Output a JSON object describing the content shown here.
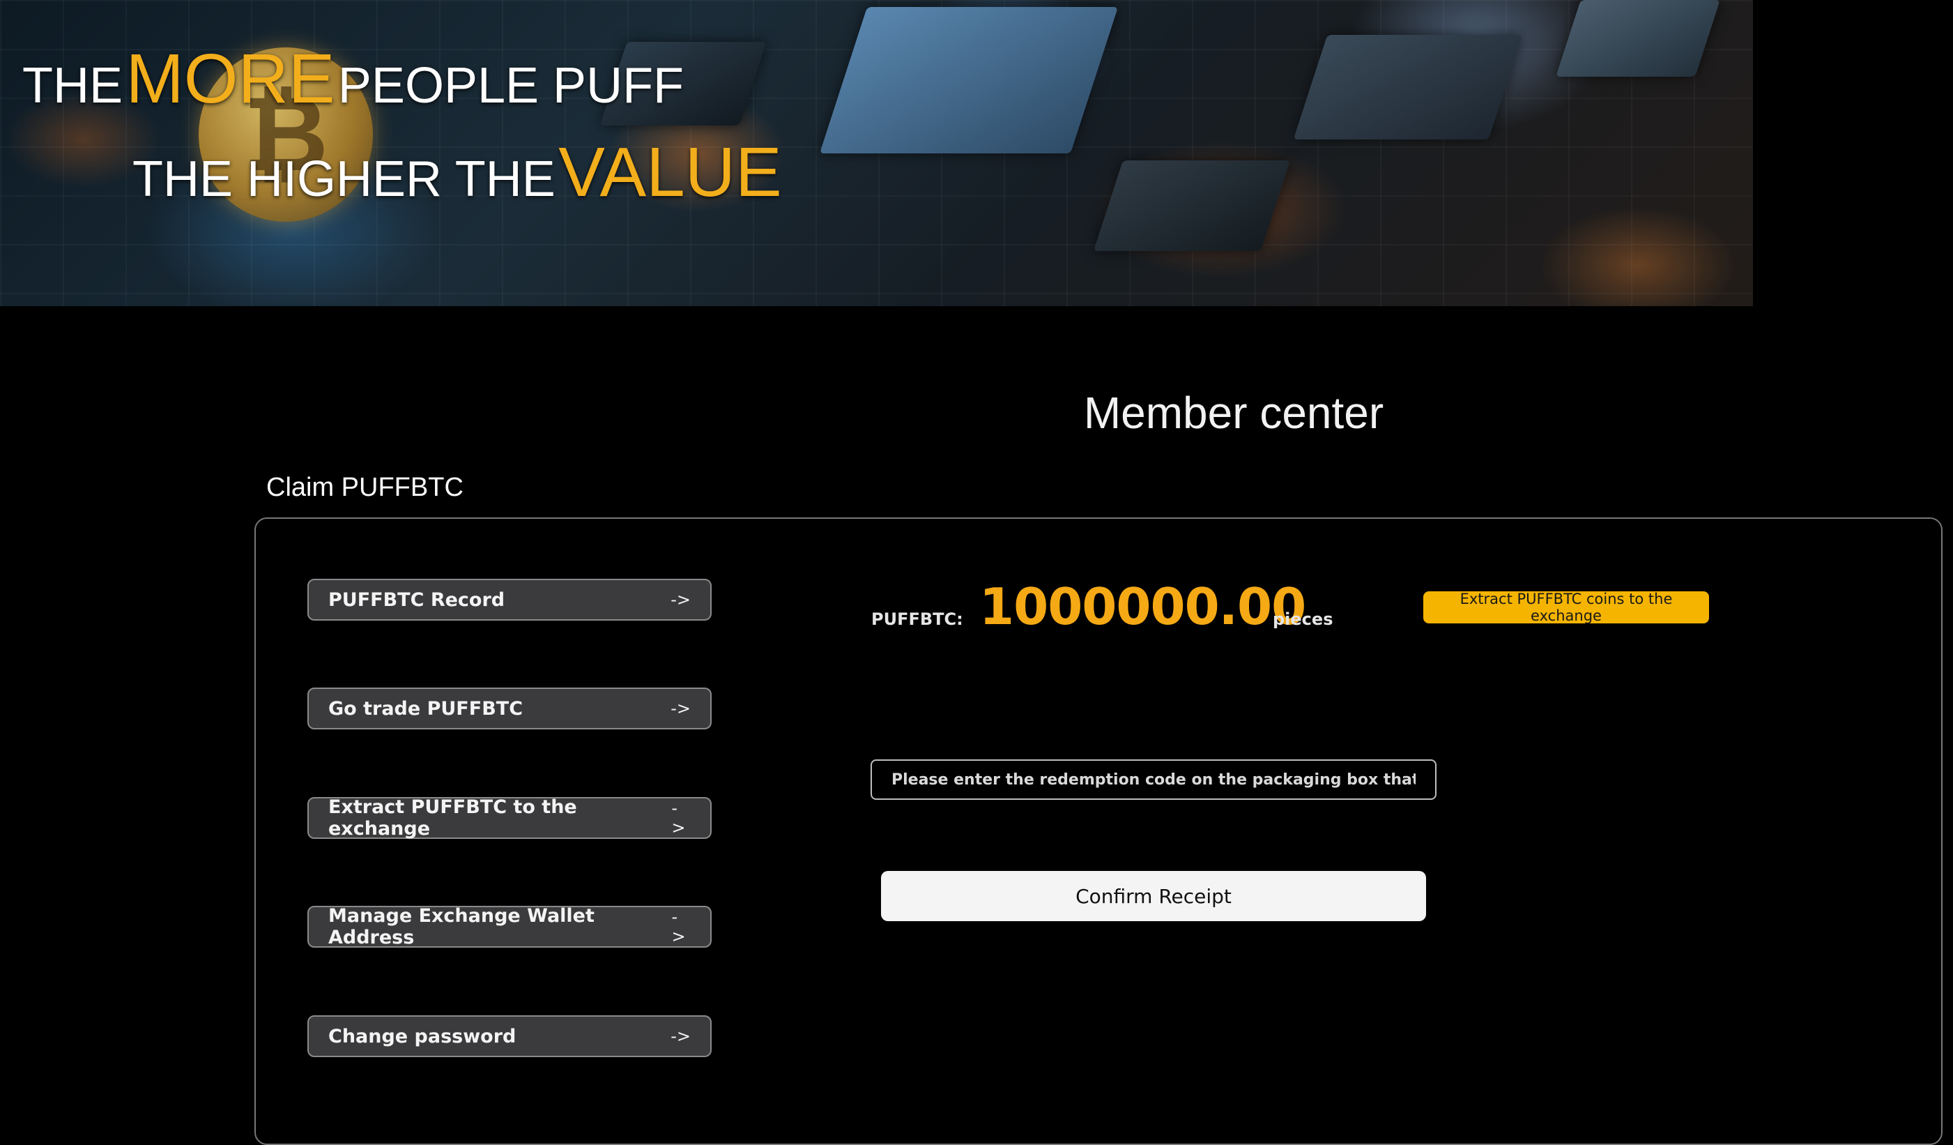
{
  "banner": {
    "line1": {
      "w1": "THE",
      "highlight": "MORE",
      "w2": "PEOPLE PUFF"
    },
    "line2": {
      "w1": "THE HIGHER THE",
      "highlight": "VALUE"
    },
    "coin_symbol": "₿",
    "accent_color": "#f3ae1b"
  },
  "page": {
    "title": "Member center",
    "section_label": "Claim PUFFBTC"
  },
  "menu": {
    "arrow": "->",
    "items": [
      {
        "label": "PUFFBTC Record"
      },
      {
        "label": "Go trade PUFFBTC"
      },
      {
        "label": "Extract PUFFBTC to the exchange"
      },
      {
        "label": "Manage Exchange Wallet Address"
      },
      {
        "label": "Change password"
      }
    ]
  },
  "balance": {
    "label": "PUFFBTC:",
    "value": "1000000.00",
    "unit": "pieces",
    "value_color": "#f5a915",
    "extract_button": "Extract PUFFBTC coins to the exchange"
  },
  "redeem": {
    "input_value": "",
    "input_placeholder": "Please enter the redemption code on the packaging box that has not been r",
    "confirm_button": "Confirm Receipt"
  }
}
